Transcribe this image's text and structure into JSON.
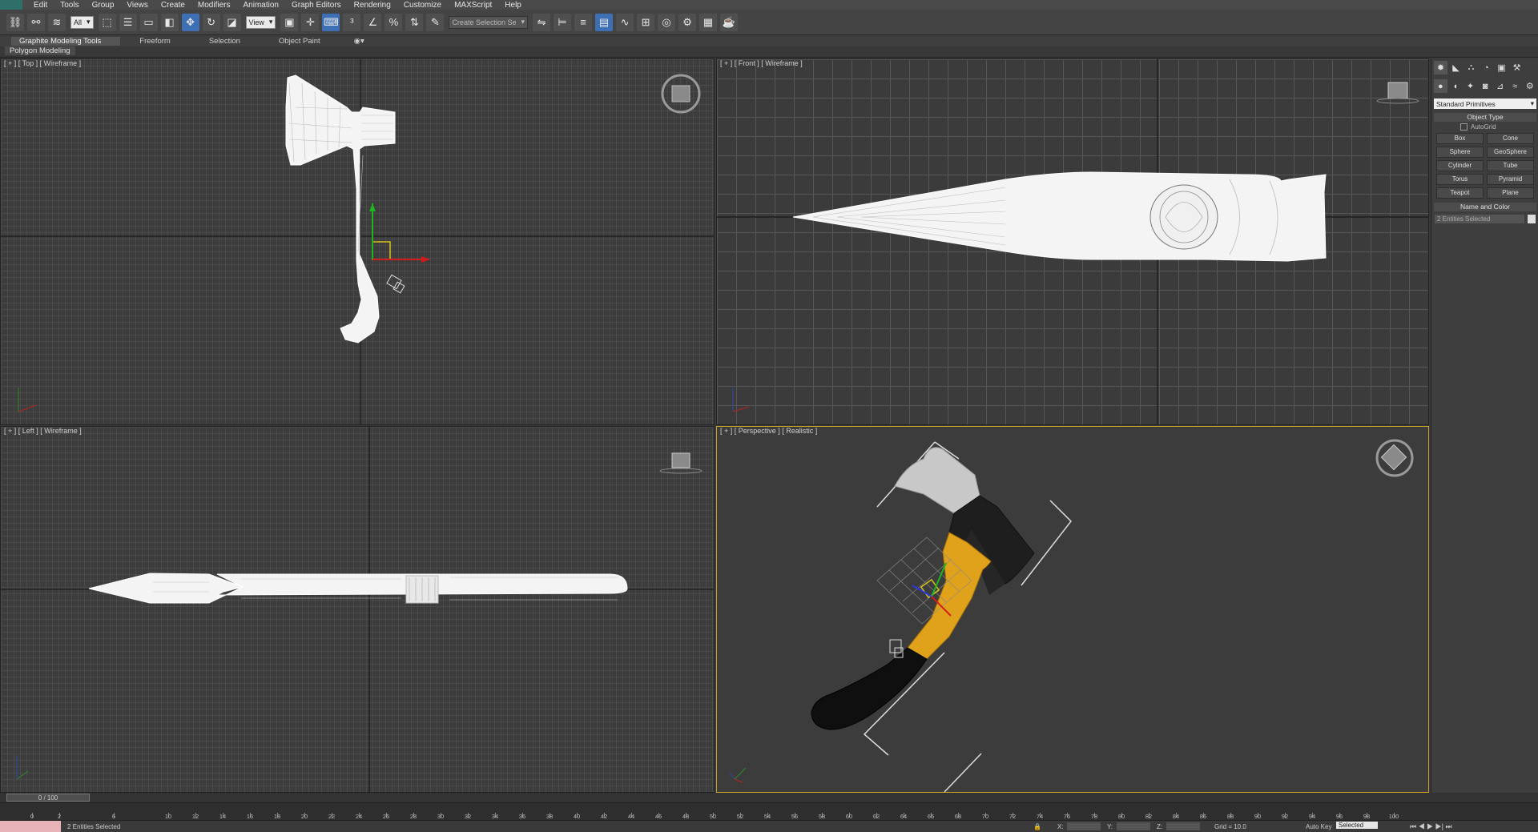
{
  "menu": {
    "items": [
      "Edit",
      "Tools",
      "Group",
      "Views",
      "Create",
      "Modifiers",
      "Animation",
      "Graph Editors",
      "Rendering",
      "Customize",
      "MAXScript",
      "Help"
    ]
  },
  "toolbar": {
    "selection_filter": "All",
    "ref_coord": "View",
    "named_selection": "Create Selection Se"
  },
  "ribbon": {
    "tabs": [
      "Graphite Modeling Tools",
      "Freeform",
      "Selection",
      "Object Paint"
    ],
    "sub": "Polygon Modeling"
  },
  "viewports": {
    "top": {
      "label": "[ + ] [ Top ] [ Wireframe ]"
    },
    "front": {
      "label": "[ + ] [ Front ] [ Wireframe ]"
    },
    "left": {
      "label": "[ + ] [ Left ] [ Wireframe ]"
    },
    "perspective": {
      "label": "[ + ] [ Perspective ] [ Realistic ]"
    }
  },
  "command_panel": {
    "dropdown": "Standard Primitives",
    "object_type_title": "Object Type",
    "autogrid": "AutoGrid",
    "buttons": [
      "Box",
      "Cone",
      "Sphere",
      "GeoSphere",
      "Cylinder",
      "Tube",
      "Torus",
      "Pyramid",
      "Teapot",
      "Plane"
    ],
    "name_color_title": "Name and Color",
    "name_value": "2 Entities Selected"
  },
  "timeline": {
    "position": "0 / 100",
    "ticks": [
      0,
      2,
      6,
      10,
      12,
      14,
      16,
      18,
      20,
      22,
      24,
      26,
      28,
      30,
      32,
      34,
      36,
      38,
      40,
      42,
      44,
      46,
      48,
      50,
      52,
      54,
      56,
      58,
      60,
      62,
      64,
      66,
      68,
      70,
      72,
      74,
      76,
      78,
      80,
      82,
      84,
      86,
      88,
      90,
      92,
      94,
      96,
      98,
      100
    ]
  },
  "status": {
    "selected": "2 Entities Selected",
    "x": "X:",
    "y": "Y:",
    "z": "Z:",
    "grid": "Grid = 10.0",
    "autokey": "Auto Key",
    "autokey_value": "Selected"
  },
  "colors": {
    "handle_yellow": "#e0a21a",
    "handle_black": "#0f0f0f",
    "head_dark": "#1e1e1e",
    "blade_grey": "#c8c8c8",
    "viewport_active": "#c9a227"
  }
}
